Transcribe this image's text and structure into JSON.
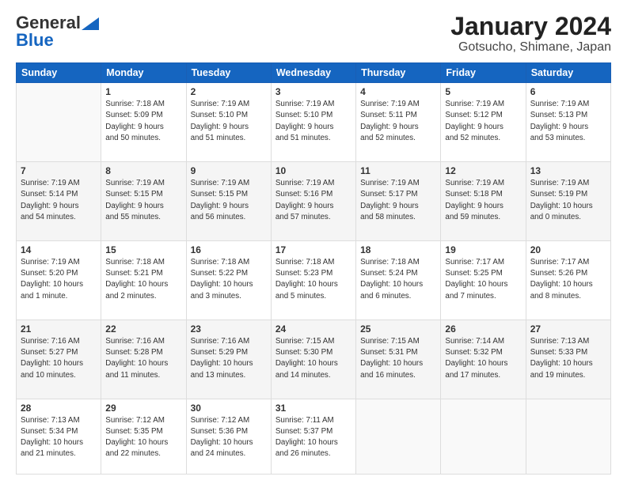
{
  "logo": {
    "general": "General",
    "blue": "Blue"
  },
  "title": "January 2024",
  "subtitle": "Gotsucho, Shimane, Japan",
  "headers": [
    "Sunday",
    "Monday",
    "Tuesday",
    "Wednesday",
    "Thursday",
    "Friday",
    "Saturday"
  ],
  "weeks": [
    [
      {
        "num": "",
        "info": ""
      },
      {
        "num": "1",
        "info": "Sunrise: 7:18 AM\nSunset: 5:09 PM\nDaylight: 9 hours\nand 50 minutes."
      },
      {
        "num": "2",
        "info": "Sunrise: 7:19 AM\nSunset: 5:10 PM\nDaylight: 9 hours\nand 51 minutes."
      },
      {
        "num": "3",
        "info": "Sunrise: 7:19 AM\nSunset: 5:10 PM\nDaylight: 9 hours\nand 51 minutes."
      },
      {
        "num": "4",
        "info": "Sunrise: 7:19 AM\nSunset: 5:11 PM\nDaylight: 9 hours\nand 52 minutes."
      },
      {
        "num": "5",
        "info": "Sunrise: 7:19 AM\nSunset: 5:12 PM\nDaylight: 9 hours\nand 52 minutes."
      },
      {
        "num": "6",
        "info": "Sunrise: 7:19 AM\nSunset: 5:13 PM\nDaylight: 9 hours\nand 53 minutes."
      }
    ],
    [
      {
        "num": "7",
        "info": "Sunrise: 7:19 AM\nSunset: 5:14 PM\nDaylight: 9 hours\nand 54 minutes."
      },
      {
        "num": "8",
        "info": "Sunrise: 7:19 AM\nSunset: 5:15 PM\nDaylight: 9 hours\nand 55 minutes."
      },
      {
        "num": "9",
        "info": "Sunrise: 7:19 AM\nSunset: 5:15 PM\nDaylight: 9 hours\nand 56 minutes."
      },
      {
        "num": "10",
        "info": "Sunrise: 7:19 AM\nSunset: 5:16 PM\nDaylight: 9 hours\nand 57 minutes."
      },
      {
        "num": "11",
        "info": "Sunrise: 7:19 AM\nSunset: 5:17 PM\nDaylight: 9 hours\nand 58 minutes."
      },
      {
        "num": "12",
        "info": "Sunrise: 7:19 AM\nSunset: 5:18 PM\nDaylight: 9 hours\nand 59 minutes."
      },
      {
        "num": "13",
        "info": "Sunrise: 7:19 AM\nSunset: 5:19 PM\nDaylight: 10 hours\nand 0 minutes."
      }
    ],
    [
      {
        "num": "14",
        "info": "Sunrise: 7:19 AM\nSunset: 5:20 PM\nDaylight: 10 hours\nand 1 minute."
      },
      {
        "num": "15",
        "info": "Sunrise: 7:18 AM\nSunset: 5:21 PM\nDaylight: 10 hours\nand 2 minutes."
      },
      {
        "num": "16",
        "info": "Sunrise: 7:18 AM\nSunset: 5:22 PM\nDaylight: 10 hours\nand 3 minutes."
      },
      {
        "num": "17",
        "info": "Sunrise: 7:18 AM\nSunset: 5:23 PM\nDaylight: 10 hours\nand 5 minutes."
      },
      {
        "num": "18",
        "info": "Sunrise: 7:18 AM\nSunset: 5:24 PM\nDaylight: 10 hours\nand 6 minutes."
      },
      {
        "num": "19",
        "info": "Sunrise: 7:17 AM\nSunset: 5:25 PM\nDaylight: 10 hours\nand 7 minutes."
      },
      {
        "num": "20",
        "info": "Sunrise: 7:17 AM\nSunset: 5:26 PM\nDaylight: 10 hours\nand 8 minutes."
      }
    ],
    [
      {
        "num": "21",
        "info": "Sunrise: 7:16 AM\nSunset: 5:27 PM\nDaylight: 10 hours\nand 10 minutes."
      },
      {
        "num": "22",
        "info": "Sunrise: 7:16 AM\nSunset: 5:28 PM\nDaylight: 10 hours\nand 11 minutes."
      },
      {
        "num": "23",
        "info": "Sunrise: 7:16 AM\nSunset: 5:29 PM\nDaylight: 10 hours\nand 13 minutes."
      },
      {
        "num": "24",
        "info": "Sunrise: 7:15 AM\nSunset: 5:30 PM\nDaylight: 10 hours\nand 14 minutes."
      },
      {
        "num": "25",
        "info": "Sunrise: 7:15 AM\nSunset: 5:31 PM\nDaylight: 10 hours\nand 16 minutes."
      },
      {
        "num": "26",
        "info": "Sunrise: 7:14 AM\nSunset: 5:32 PM\nDaylight: 10 hours\nand 17 minutes."
      },
      {
        "num": "27",
        "info": "Sunrise: 7:13 AM\nSunset: 5:33 PM\nDaylight: 10 hours\nand 19 minutes."
      }
    ],
    [
      {
        "num": "28",
        "info": "Sunrise: 7:13 AM\nSunset: 5:34 PM\nDaylight: 10 hours\nand 21 minutes."
      },
      {
        "num": "29",
        "info": "Sunrise: 7:12 AM\nSunset: 5:35 PM\nDaylight: 10 hours\nand 22 minutes."
      },
      {
        "num": "30",
        "info": "Sunrise: 7:12 AM\nSunset: 5:36 PM\nDaylight: 10 hours\nand 24 minutes."
      },
      {
        "num": "31",
        "info": "Sunrise: 7:11 AM\nSunset: 5:37 PM\nDaylight: 10 hours\nand 26 minutes."
      },
      {
        "num": "",
        "info": ""
      },
      {
        "num": "",
        "info": ""
      },
      {
        "num": "",
        "info": ""
      }
    ]
  ]
}
